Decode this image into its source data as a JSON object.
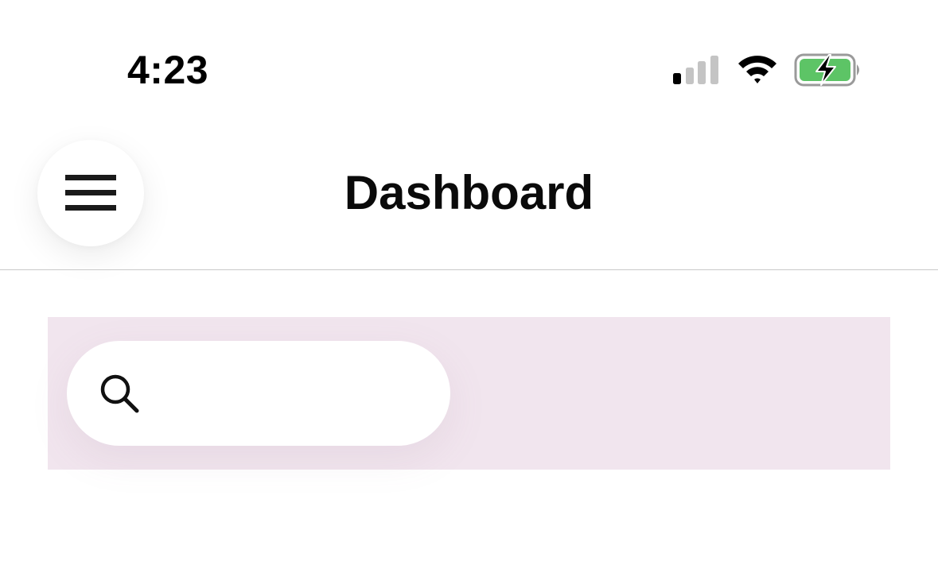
{
  "status_bar": {
    "time": "4:23",
    "signal_icon": "cellular-signal-icon",
    "wifi_icon": "wifi-icon",
    "battery_icon": "battery-charging-icon",
    "battery_color": "#5dc466"
  },
  "header": {
    "title": "Dashboard",
    "menu_icon": "hamburger-menu-icon"
  },
  "search": {
    "value": "",
    "placeholder": "",
    "icon": "search-icon",
    "panel_color": "#f1e5ee"
  }
}
